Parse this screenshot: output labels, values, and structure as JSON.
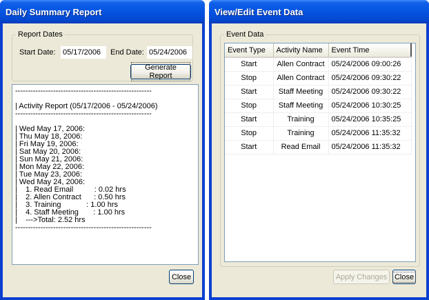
{
  "summary": {
    "title": "Daily Summary Report",
    "group_label": "Report Dates",
    "start_label": "Start Date:",
    "start_value": "05/17/2006",
    "end_label": "End Date:",
    "end_value": "05/24/2006",
    "generate_label": "Generate Report",
    "close_label": "Close",
    "report_lines": [
      "------------------------------------------------------",
      "| Activity Report (05/17/2006 - 05/24/2006)",
      "------------------------------------------------------",
      "| Wed May 17, 2006:",
      "| Thu May 18, 2006:",
      "| Fri May 19, 2006:",
      "| Sat May 20, 2006:",
      "| Sun May 21, 2006:",
      "| Mon May 22, 2006:",
      "| Tue May 23, 2006:",
      "| Wed May 24, 2006:",
      "|    1. Read Email          : 0.02 hrs",
      "|    2. Allen Contract      : 0.50 hrs",
      "|    3. Training            : 1.00 hrs",
      "|    4. Staff Meeting       : 1.00 hrs",
      "|    --->Total: 2.52 hrs",
      "------------------------------------------------------"
    ]
  },
  "events": {
    "title": "View/Edit Event Data",
    "group_label": "Event Data",
    "columns": [
      "Event Type",
      "Activity Name",
      "Event Time"
    ],
    "rows": [
      [
        "Start",
        "Allen Contract",
        "05/24/2006 09:00:26"
      ],
      [
        "Stop",
        "Allen Contract",
        "05/24/2006 09:30:22"
      ],
      [
        "Start",
        "Staff Meeting",
        "05/24/2006 09:30:22"
      ],
      [
        "Stop",
        "Staff Meeting",
        "05/24/2006 10:30:25"
      ],
      [
        "Start",
        "Training",
        "05/24/2006 10:35:25"
      ],
      [
        "Stop",
        "Training",
        "05/24/2006 11:35:32"
      ],
      [
        "Start",
        "Read Email",
        "05/24/2006 11:35:32"
      ]
    ],
    "apply_label": "Apply Changes",
    "close_label": "Close"
  },
  "colors": {
    "titlebar": "#0554e2",
    "client": "#ece9d8"
  }
}
